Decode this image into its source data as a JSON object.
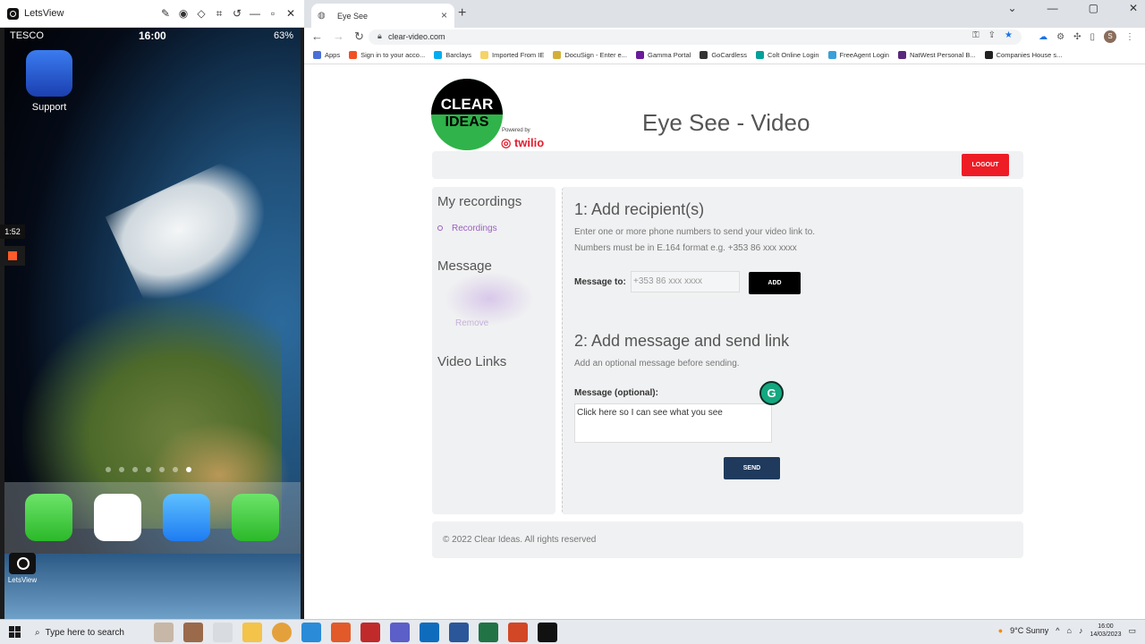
{
  "letsview": {
    "title": "LetsView",
    "phone": {
      "carrier": "TESCO",
      "time": "16:00",
      "battery": "63%",
      "home_app_label": "Support",
      "page_count": 7,
      "active_page": 7,
      "dock_apps": [
        "Phone",
        "Outlook",
        "Mail",
        "Messages"
      ]
    },
    "side_timer": "1:52",
    "desktop_icon_label": "LetsView"
  },
  "browser": {
    "tab_title": "Eye See",
    "url": "clear-video.com",
    "bookmarks": [
      {
        "label": "Apps",
        "color": "#4a6fd8"
      },
      {
        "label": "Sign in to your acco...",
        "color": "#f25022"
      },
      {
        "label": "Barclays",
        "color": "#00aeef"
      },
      {
        "label": "Imported From IE",
        "color": "#f6d365"
      },
      {
        "label": "DocuSign - Enter e...",
        "color": "#d4af37"
      },
      {
        "label": "Gamma Portal",
        "color": "#6a1b9a"
      },
      {
        "label": "GoCardless",
        "color": "#333333"
      },
      {
        "label": "Colt Online Login",
        "color": "#00a19a"
      },
      {
        "label": "FreeAgent Login",
        "color": "#3aa0d8"
      },
      {
        "label": "NatWest Personal B...",
        "color": "#5a287d"
      },
      {
        "label": "Companies House s...",
        "color": "#222222"
      }
    ]
  },
  "page": {
    "logo_line1": "CLEAR",
    "logo_line2": "IDEAS",
    "powered_by": "Powered by",
    "twilio": "twilio",
    "title": "Eye See - Video",
    "logout_label": "LOGOUT",
    "sidebar": {
      "recordings_heading": "My recordings",
      "recordings_link": "Recordings",
      "message_heading": "Message",
      "remove_label": "Remove",
      "video_links_heading": "Video Links"
    },
    "step1": {
      "heading": "1: Add recipient(s)",
      "help1": "Enter one or more phone numbers to send your video link to.",
      "help2": "Numbers must be in E.164 format e.g. +353 86 xxx xxxx",
      "label": "Message to:",
      "placeholder": "+353 86 xxx xxxx",
      "add_label": "ADD"
    },
    "step2": {
      "heading": "2: Add message and send link",
      "help": "Add an optional message before sending.",
      "label": "Message (optional):",
      "message_value": "Click here so I can see what you see",
      "send_label": "SEND"
    },
    "footer": "© 2022 Clear Ideas. All rights reserved"
  },
  "taskbar": {
    "search_placeholder": "Type here to search",
    "weather": "9°C  Sunny",
    "time": "16:00",
    "date": "14/03/2023"
  },
  "colors": {
    "logout_red": "#ee1c25",
    "send_navy": "#1f3a5c",
    "link_purple": "#9b5fc0",
    "brand_green": "#2fb34a"
  }
}
